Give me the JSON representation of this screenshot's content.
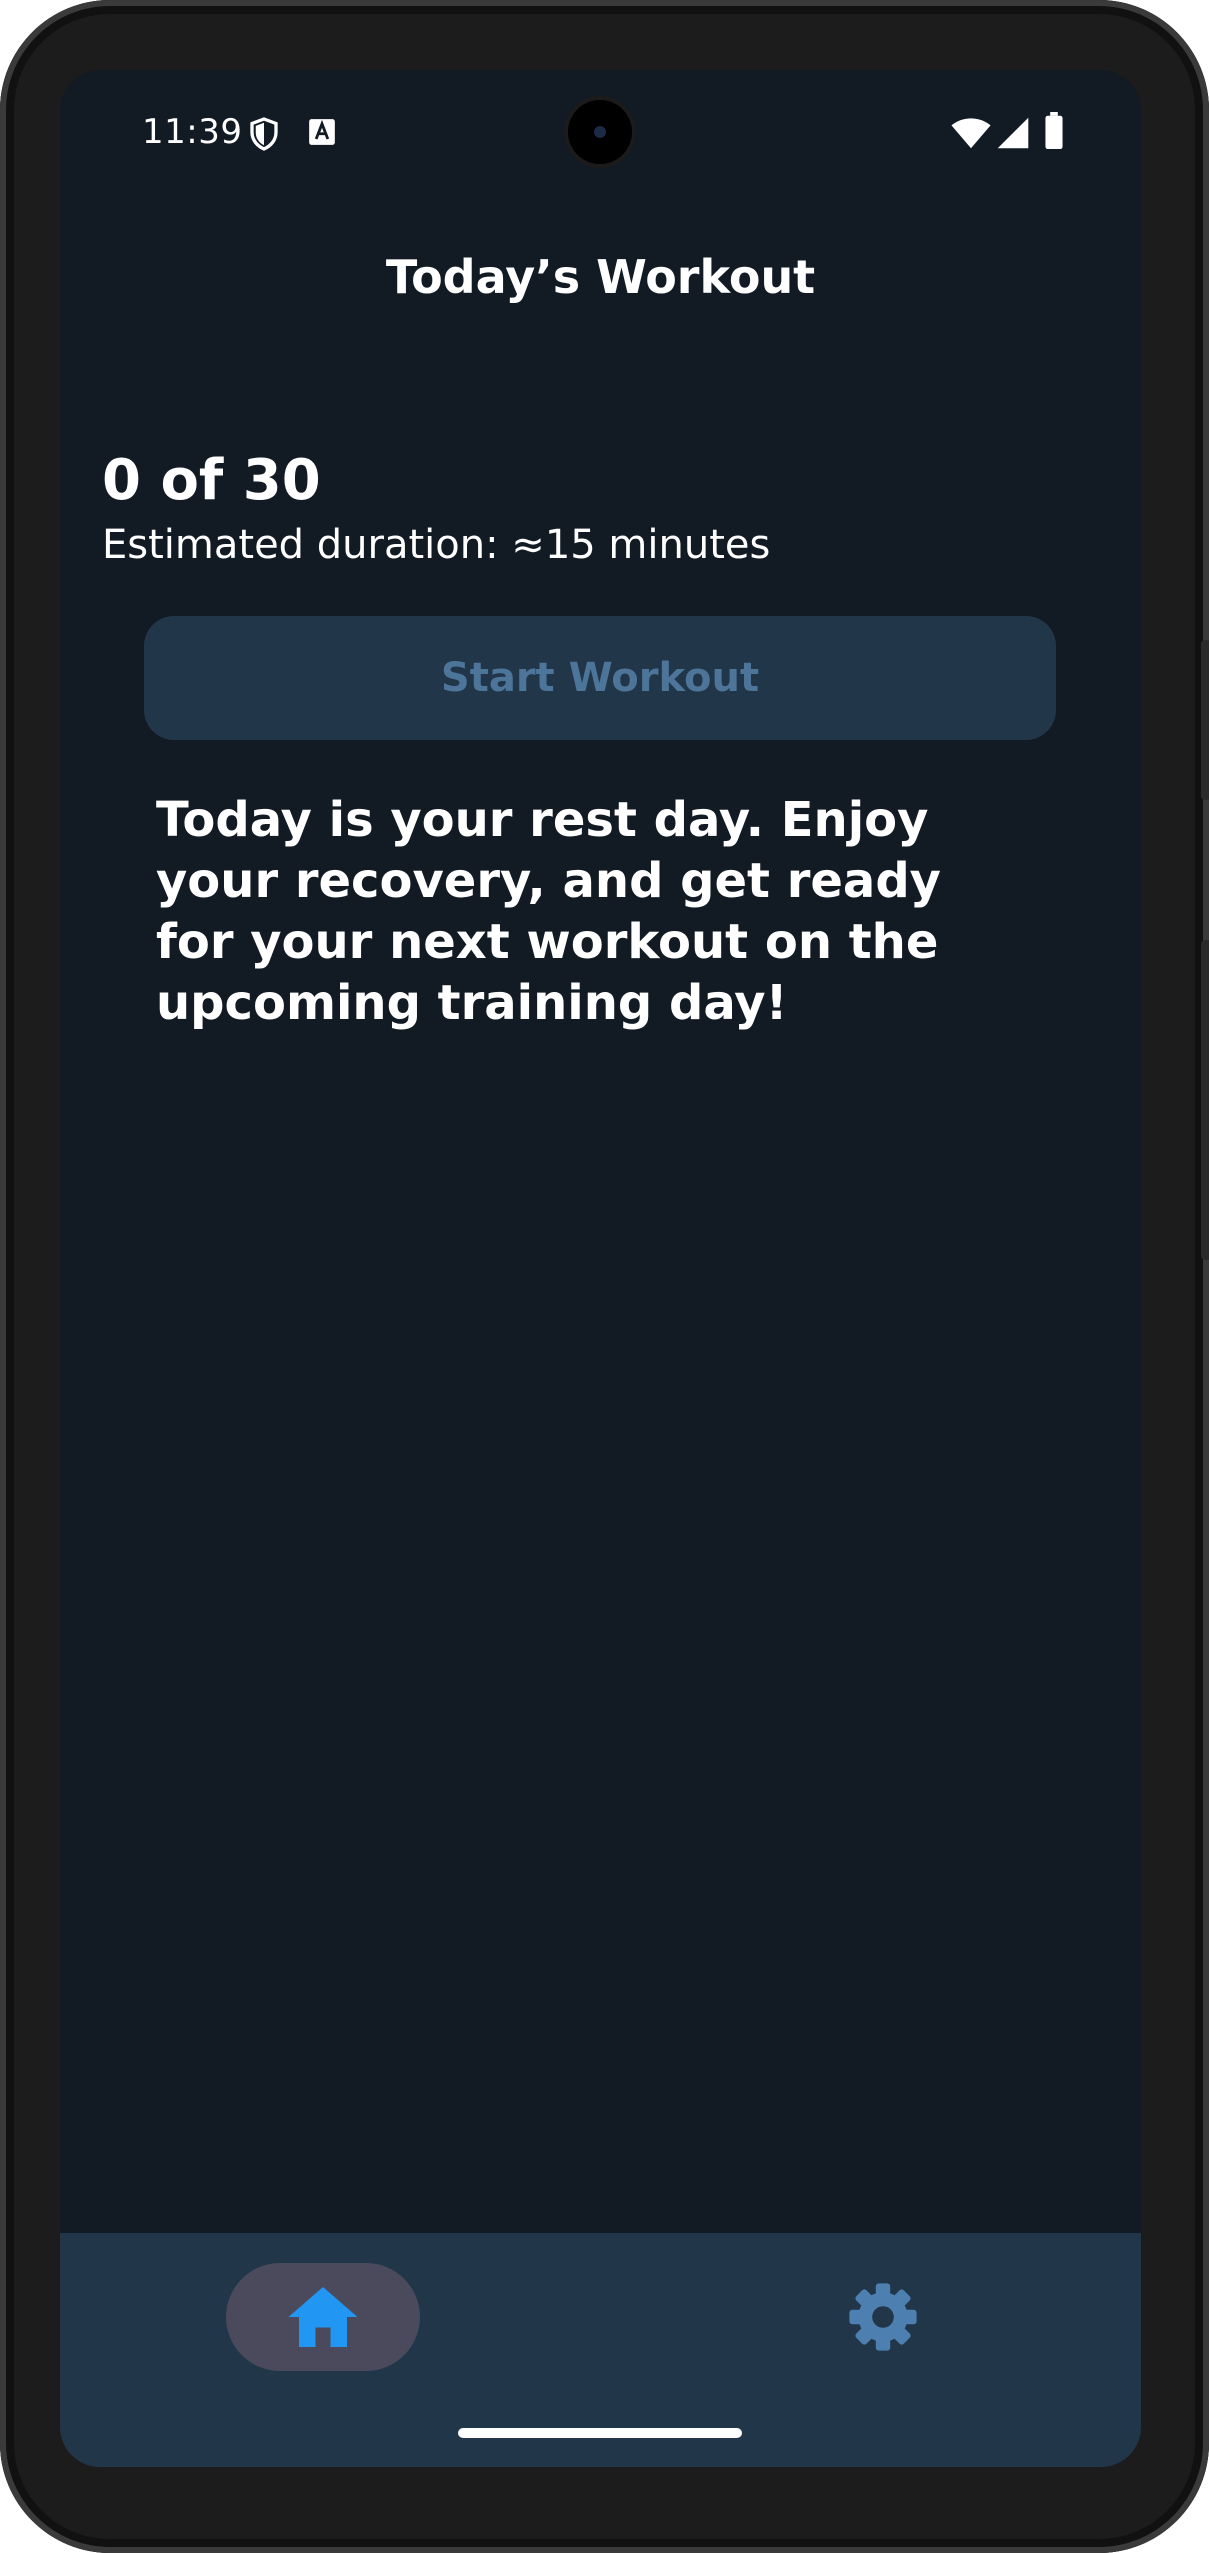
{
  "status_bar": {
    "time": "11:39",
    "icons": [
      "shield-icon",
      "a-icon",
      "wifi-icon",
      "signal-icon",
      "battery-icon"
    ]
  },
  "header": {
    "title": "Today’s Workout"
  },
  "progress": {
    "count_text": "0 of 30",
    "duration_text": "Estimated duration: ≈15 minutes"
  },
  "actions": {
    "start_label": "Start Workout"
  },
  "message": {
    "rest_day": "Today is your rest day. Enjoy your recovery, and get ready for your next workout on the upcoming training day!"
  },
  "bottom_nav": {
    "items": [
      {
        "icon": "home-icon",
        "selected": true
      },
      {
        "icon": "gear-icon",
        "selected": false
      }
    ]
  },
  "colors": {
    "background": "#121a23",
    "surface": "#22364a",
    "accent": "#2196f3",
    "muted_button_text": "#4d7499",
    "nav_selected_pill": "#4a4a5c"
  }
}
